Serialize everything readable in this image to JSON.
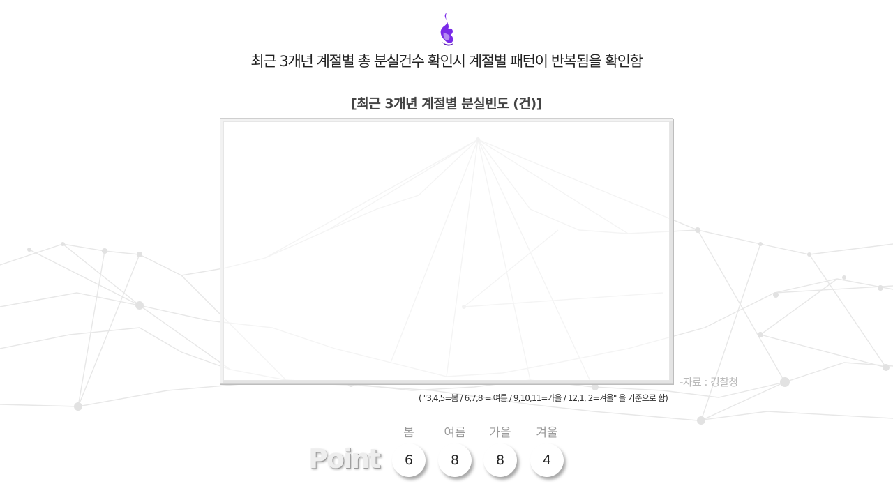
{
  "header": {
    "title": "최근 3개년 계절별 총 분실건수 확인시 계절별 패턴이 반복됨을 확인함"
  },
  "chart": {
    "title": "[최근 3개년 계절별 분실빈도 (건)]",
    "source": "-자료 : 경찰청",
    "criteria": "(    \"3,4,5=봄 / 6,7,8 = 여름 / 9,10,11=가을 / 12,1, 2=겨울\"  을 기준으로 함)"
  },
  "points": {
    "label": "Point",
    "items": [
      {
        "season": "봄",
        "value": "6"
      },
      {
        "season": "여름",
        "value": "8"
      },
      {
        "season": "가을",
        "value": "8"
      },
      {
        "season": "겨울",
        "value": "4"
      }
    ]
  },
  "colors": {
    "logo_purple": "#7a2be8",
    "network_gray": "#e4e4e4"
  }
}
